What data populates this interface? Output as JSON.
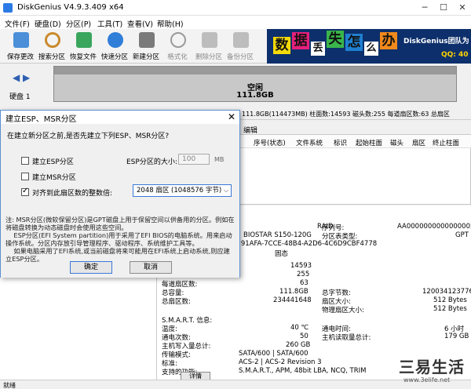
{
  "app": {
    "title": "DiskGenius V4.9.3.409 x64",
    "minimize": "─",
    "maximize": "☐",
    "close": "✕"
  },
  "menu": [
    "文件(F)",
    "硬盘(D)",
    "分区(P)",
    "工具(T)",
    "查看(V)",
    "帮助(H)"
  ],
  "toolbar": [
    {
      "label": "保存更改",
      "icon": "save-icon",
      "color": "#4a8fd8"
    },
    {
      "label": "搜索分区",
      "icon": "search-icon",
      "color": "#c98b2d"
    },
    {
      "label": "恢复文件",
      "icon": "recover-icon",
      "color": "#3aa55d"
    },
    {
      "label": "快速分区",
      "icon": "quick-partition-icon",
      "color": "#2f7ed8"
    },
    {
      "label": "新建分区",
      "icon": "new-partition-icon",
      "color": "#7a7a7a"
    },
    {
      "label": "格式化",
      "icon": "format-icon",
      "color": "#9a9a9a"
    },
    {
      "label": "删除分区",
      "icon": "delete-icon",
      "color": "#9a9a9a"
    },
    {
      "label": "备份分区",
      "icon": "backup-icon",
      "color": "#9a9a9a"
    }
  ],
  "banner": {
    "chars": [
      {
        "text": "数",
        "bg": "#f5d90a"
      },
      {
        "text": "据",
        "bg": "#e5207a"
      },
      {
        "text": "丢",
        "bg": "#ffffff"
      },
      {
        "text": "失",
        "bg": "#3ab54a"
      },
      {
        "text": "怎",
        "bg": "#1f7fd0"
      },
      {
        "text": "么",
        "bg": "#ffffff"
      },
      {
        "text": "办",
        "bg": "#f08a1c"
      }
    ],
    "brand": "DiskGenius团队为",
    "qq": "QQ: 40"
  },
  "disk": {
    "label": "硬盘 1",
    "partition_name": "空闲",
    "partition_size": "111.8GB"
  },
  "info_strip": "111.8GB(114473MB)  柱面数:14593  磁头数:255  每道扇区数:63  总扇区",
  "right_tab": "编辑",
  "table_headers": [
    "序号(状态)",
    "文件系统",
    "标识",
    "起始柱面",
    "磁头",
    "扇区",
    "终止柱面"
  ],
  "details": {
    "raid": "RAID",
    "model": "BIOSTAR S150-120G",
    "guid": "4191AFA-7CCE-48B4-A2D6-4C6D9CBF4778",
    "fixed": "固态",
    "serial_label": "序列号:",
    "serial_value": "AA000000000000000581",
    "partition_type_label": "分区表类型:",
    "partition_type_value": "GPT",
    "cyl": "14593",
    "heads": "255",
    "sectors": "63",
    "capacity_label": "总容量:",
    "capacity_value": "111.8GB",
    "total_sectors_label": "总扇区数:",
    "total_sectors_value": "234441648",
    "per_track_label": "每道扇区数:",
    "total_bytes_label": "总字节数:",
    "total_bytes_value": "120034123776",
    "sector_size_label": "扇区大小:",
    "sector_size_value": "512 Bytes",
    "phys_sector_label": "物理扇区大小:",
    "phys_sector_value": "512 Bytes",
    "smart_label": "S.M.A.R.T. 信息:",
    "temp_label": "温度:",
    "temp_value": "40 ℃",
    "power_count_label": "通电次数:",
    "power_count_value": "50",
    "host_writes_label": "主机写入量总计:",
    "host_writes_value": "260 GB",
    "power_time_label": "通电时间:",
    "power_time_value": "6 小时",
    "host_reads_label": "主机读取量总计:",
    "host_reads_value": "179 GB",
    "transfer_label": "传输模式:",
    "transfer_value": "SATA/600 | SATA/600",
    "standard_label": "标准:",
    "standard_value": "ACS-2 | ACS-2 Revision 3",
    "features_label": "支持的功能:",
    "features_value": "S.M.A.R.T., APM, 48bit LBA, NCQ, TRIM",
    "detail_button": "详情"
  },
  "status": "就绪",
  "watermark": {
    "big": "三易生活",
    "small": "www.3elife.net"
  },
  "dialog": {
    "title": "建立ESP、MSR分区",
    "close": "✕",
    "question": "在建立新分区之前,是否先建立下列ESP、MSR分区?",
    "esp_checkbox": "建立ESP分区",
    "esp_checked": false,
    "esp_size_label": "ESP分区的大小:",
    "esp_size_value": "100",
    "esp_size_unit": "MB",
    "msr_checkbox": "建立MSR分区",
    "msr_checked": false,
    "align_checkbox": "对齐到此扇区数的整数倍:",
    "align_checked": true,
    "align_value": "2048 扇区 (1048576 字节)",
    "note": "注: MSR分区(微软保留分区)是GPT磁盘上用于保留空间以供备用的分区。例如在将磁盘转换为动态磁盘时会使用这些空间。\n    ESP分区(EFI System partition)用于采用了EFI BIOS的电脑系统。用来启动操作系统。分区内存放引导管理程序、驱动程序、系统维护工具等。\n    如果电脑采用了EFI系统,或当前磁盘将来可能用在EFI系统上启动系统,则应建立ESP分区。",
    "ok": "确定",
    "cancel": "取消"
  }
}
